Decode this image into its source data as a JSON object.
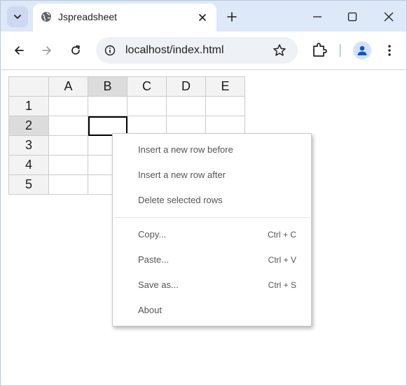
{
  "browser": {
    "tab_title": "Jspreadsheet",
    "url": "localhost/index.html"
  },
  "sheet": {
    "columns": [
      "A",
      "B",
      "C",
      "D",
      "E"
    ],
    "rows": [
      "1",
      "2",
      "3",
      "4",
      "5"
    ],
    "selected_column": "B",
    "selected_row": "2"
  },
  "context_menu": {
    "items": [
      {
        "label": "Insert a new row before",
        "shortcut": ""
      },
      {
        "label": "Insert a new row after",
        "shortcut": ""
      },
      {
        "label": "Delete selected rows",
        "shortcut": ""
      },
      {
        "label": "Copy...",
        "shortcut": "Ctrl + C"
      },
      {
        "label": "Paste...",
        "shortcut": "Ctrl + V"
      },
      {
        "label": "Save as...",
        "shortcut": "Ctrl + S"
      },
      {
        "label": "About",
        "shortcut": ""
      }
    ]
  },
  "colors": {
    "tabstrip": "#dde8f8",
    "header_bg": "#f3f3f3",
    "header_selected": "#dcdcdc",
    "accent": "#1a73e8"
  }
}
